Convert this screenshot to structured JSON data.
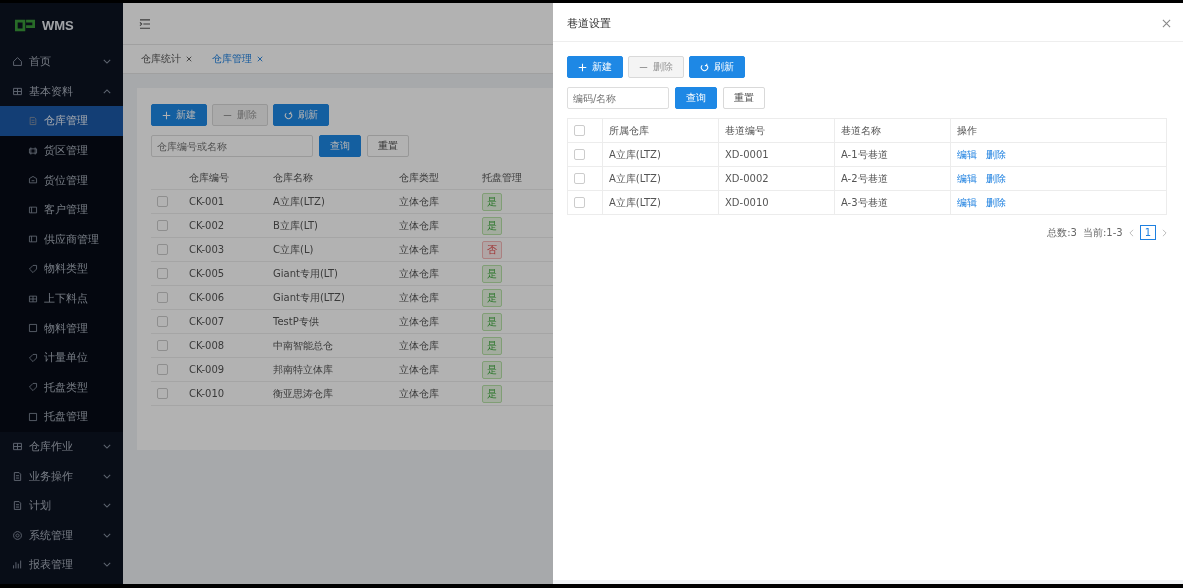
{
  "app": {
    "name": "WMS"
  },
  "sidebar": {
    "items": [
      {
        "label": "首页",
        "expanded": false
      },
      {
        "label": "基本资料",
        "expanded": true,
        "children": [
          {
            "label": "仓库管理",
            "selected": true
          },
          {
            "label": "货区管理",
            "selected": false
          },
          {
            "label": "货位管理",
            "selected": false
          },
          {
            "label": "客户管理",
            "selected": false
          },
          {
            "label": "供应商管理",
            "selected": false
          },
          {
            "label": "物料类型",
            "selected": false
          },
          {
            "label": "上下料点",
            "selected": false
          },
          {
            "label": "物料管理",
            "selected": false
          },
          {
            "label": "计量单位",
            "selected": false
          },
          {
            "label": "托盘类型",
            "selected": false
          },
          {
            "label": "托盘管理",
            "selected": false
          }
        ]
      },
      {
        "label": "仓库作业",
        "expanded": false
      },
      {
        "label": "业务操作",
        "expanded": false
      },
      {
        "label": "计划",
        "expanded": false
      },
      {
        "label": "系统管理",
        "expanded": false
      },
      {
        "label": "报表管理",
        "expanded": false
      }
    ]
  },
  "tabs": [
    {
      "label": "仓库统计",
      "selected": false
    },
    {
      "label": "仓库管理",
      "selected": true
    }
  ],
  "page": {
    "buttons": [
      {
        "label": "新建",
        "kind": "add",
        "disabled": false
      },
      {
        "label": "删除",
        "kind": "remove",
        "disabled": true
      },
      {
        "label": "刷新",
        "kind": "refresh",
        "disabled": false
      }
    ],
    "search": {
      "placeholder": "仓库编号或名称"
    },
    "query": "查询",
    "reset": "重置",
    "table": {
      "columns": [
        "仓库编号",
        "仓库名称",
        "仓库类型",
        "托盘管理"
      ],
      "rows": [
        {
          "code": "CK-001",
          "name": "A立库(LTZ)",
          "type": "立体仓库",
          "pallet": "是",
          "on": true,
          "checked": false
        },
        {
          "code": "CK-002",
          "name": "B立库(LT)",
          "type": "立体仓库",
          "pallet": "是",
          "on": true,
          "checked": false
        },
        {
          "code": "CK-003",
          "name": "C立库(L)",
          "type": "立体仓库",
          "pallet": "否",
          "on": false,
          "checked": false
        },
        {
          "code": "CK-005",
          "name": "Giant专用(LT)",
          "type": "立体仓库",
          "pallet": "是",
          "on": true,
          "checked": false
        },
        {
          "code": "CK-006",
          "name": "Giant专用(LTZ)",
          "type": "立体仓库",
          "pallet": "是",
          "on": true,
          "checked": false
        },
        {
          "code": "CK-007",
          "name": "TestP专供",
          "type": "立体仓库",
          "pallet": "是",
          "on": true,
          "checked": false
        },
        {
          "code": "CK-008",
          "name": "中南智能总仓",
          "type": "立体仓库",
          "pallet": "是",
          "on": true,
          "checked": false
        },
        {
          "code": "CK-009",
          "name": "邦南特立体库",
          "type": "立体仓库",
          "pallet": "是",
          "on": true,
          "checked": false
        },
        {
          "code": "CK-010",
          "name": "衡亚思涛仓库",
          "type": "立体仓库",
          "pallet": "是",
          "on": true,
          "checked": false
        }
      ]
    }
  },
  "drawer": {
    "title": "巷道设置",
    "buttons": [
      {
        "label": "新建",
        "kind": "add",
        "disabled": false
      },
      {
        "label": "删除",
        "kind": "remove",
        "disabled": true
      },
      {
        "label": "刷新",
        "kind": "refresh",
        "disabled": false
      }
    ],
    "search": {
      "placeholder": "编码/名称"
    },
    "query": "查询",
    "reset": "重置",
    "table": {
      "select_all": {
        "checked": false
      },
      "columns": [
        "所属仓库",
        "巷道编号",
        "巷道名称",
        "操作"
      ],
      "rows": [
        {
          "warehouse": "A立库(LTZ)",
          "code": "XD-0001",
          "name": "A-1号巷道",
          "edit": "编辑",
          "delete": "删除",
          "checked": false
        },
        {
          "warehouse": "A立库(LTZ)",
          "code": "XD-0002",
          "name": "A-2号巷道",
          "edit": "编辑",
          "delete": "删除",
          "checked": false
        },
        {
          "warehouse": "A立库(LTZ)",
          "code": "XD-0010",
          "name": "A-3号巷道",
          "edit": "编辑",
          "delete": "删除",
          "checked": false
        }
      ]
    },
    "pagination": {
      "total": "总数:3",
      "range": "当前:1-3",
      "pages": [
        {
          "label": "1",
          "selected": true
        }
      ]
    }
  }
}
